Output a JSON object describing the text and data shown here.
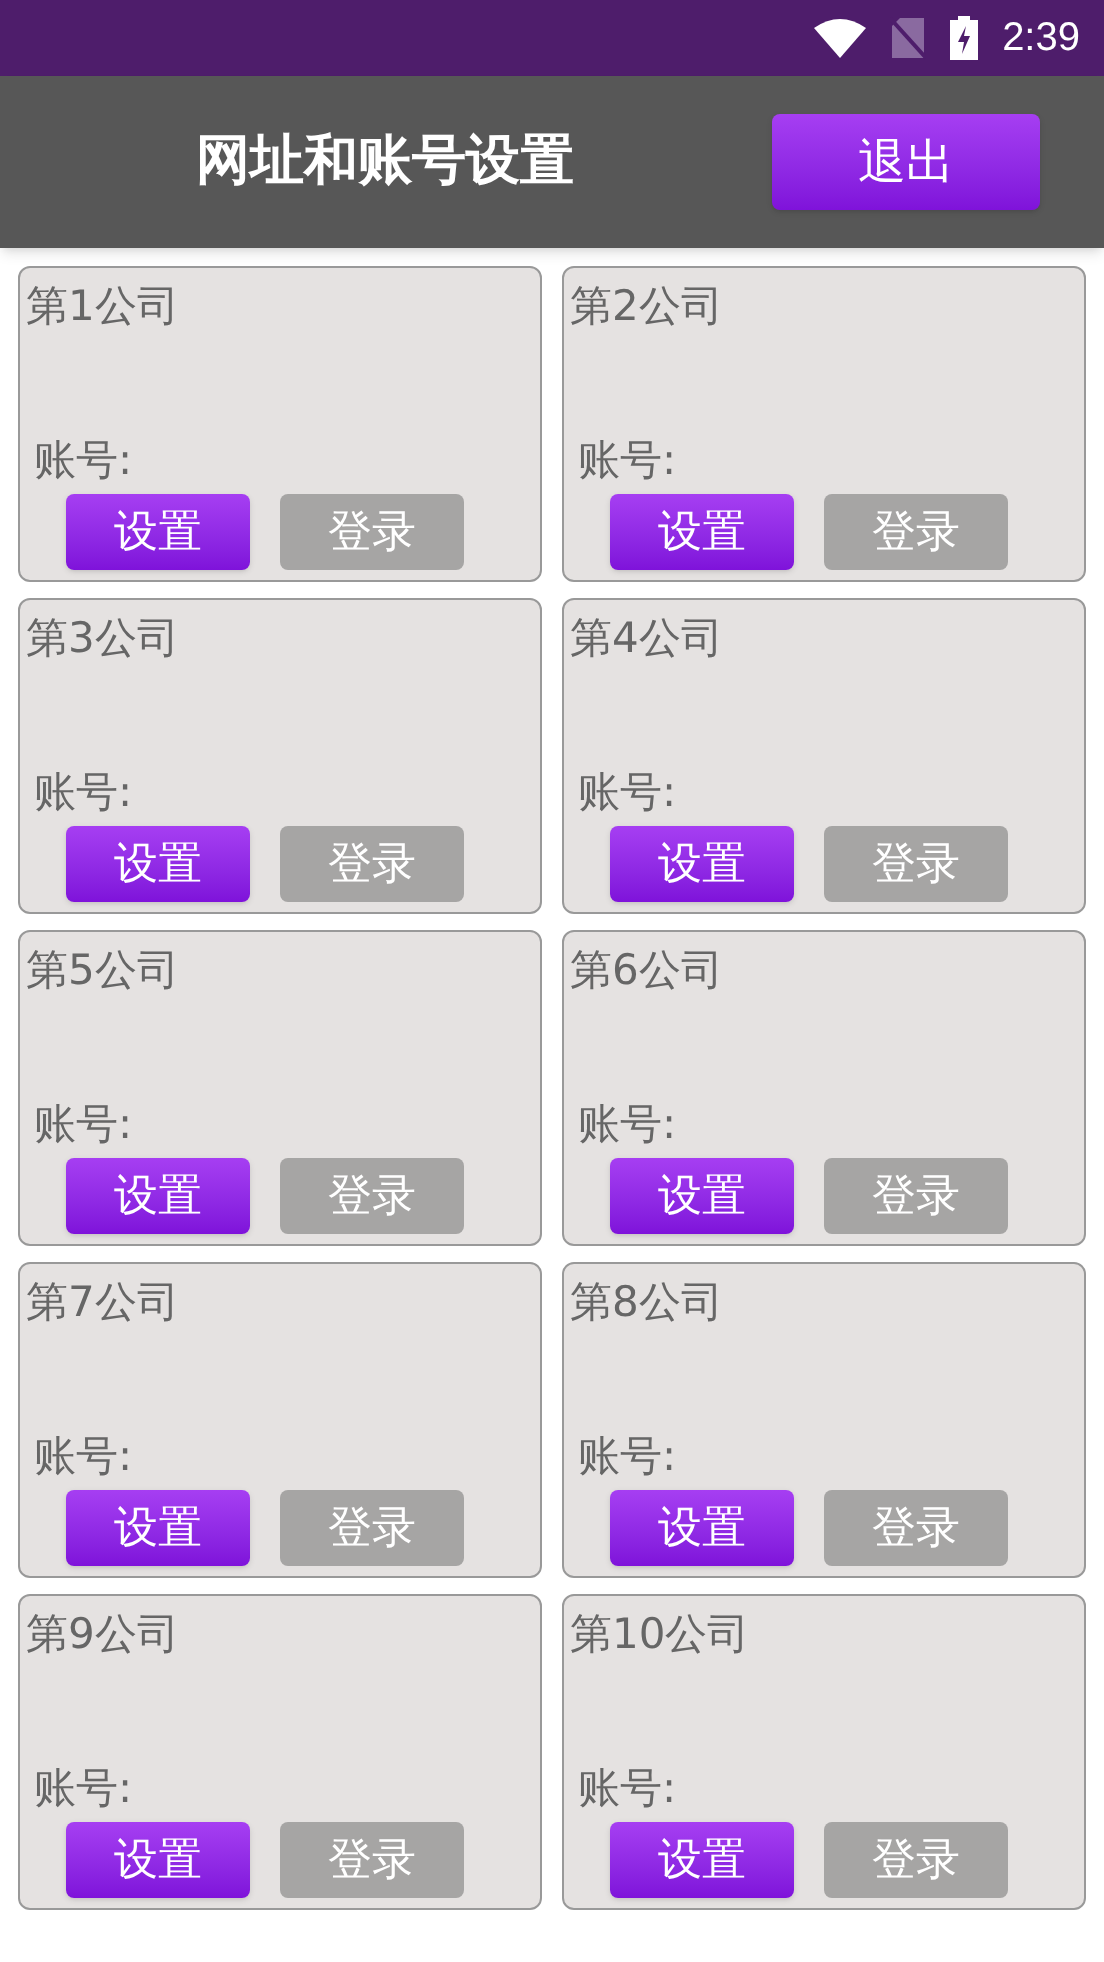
{
  "status_bar": {
    "time": "2:39"
  },
  "header": {
    "title": "网址和账号设置",
    "exit_button": "退出"
  },
  "companies": [
    {
      "name": "第1公司",
      "account_label": "账号:",
      "set_button": "设置",
      "login_button": "登录"
    },
    {
      "name": "第2公司",
      "account_label": "账号:",
      "set_button": "设置",
      "login_button": "登录"
    },
    {
      "name": "第3公司",
      "account_label": "账号:",
      "set_button": "设置",
      "login_button": "登录"
    },
    {
      "name": "第4公司",
      "account_label": "账号:",
      "set_button": "设置",
      "login_button": "登录"
    },
    {
      "name": "第5公司",
      "account_label": "账号:",
      "set_button": "设置",
      "login_button": "登录"
    },
    {
      "name": "第6公司",
      "account_label": "账号:",
      "set_button": "设置",
      "login_button": "登录"
    },
    {
      "name": "第7公司",
      "account_label": "账号:",
      "set_button": "设置",
      "login_button": "登录"
    },
    {
      "name": "第8公司",
      "account_label": "账号:",
      "set_button": "设置",
      "login_button": "登录"
    },
    {
      "name": "第9公司",
      "account_label": "账号:",
      "set_button": "设置",
      "login_button": "登录"
    },
    {
      "name": "第10公司",
      "account_label": "账号:",
      "set_button": "设置",
      "login_button": "登录"
    }
  ]
}
